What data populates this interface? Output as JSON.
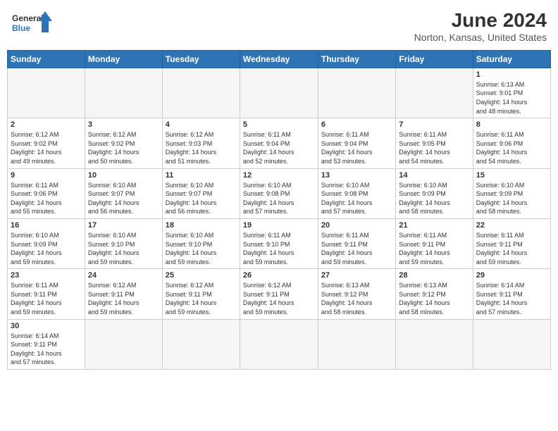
{
  "header": {
    "logo_line1": "General",
    "logo_line2": "Blue",
    "month_year": "June 2024",
    "location": "Norton, Kansas, United States"
  },
  "weekdays": [
    "Sunday",
    "Monday",
    "Tuesday",
    "Wednesday",
    "Thursday",
    "Friday",
    "Saturday"
  ],
  "weeks": [
    [
      {
        "day": "",
        "info": ""
      },
      {
        "day": "",
        "info": ""
      },
      {
        "day": "",
        "info": ""
      },
      {
        "day": "",
        "info": ""
      },
      {
        "day": "",
        "info": ""
      },
      {
        "day": "",
        "info": ""
      },
      {
        "day": "1",
        "info": "Sunrise: 6:13 AM\nSunset: 9:01 PM\nDaylight: 14 hours\nand 48 minutes."
      }
    ],
    [
      {
        "day": "2",
        "info": "Sunrise: 6:12 AM\nSunset: 9:02 PM\nDaylight: 14 hours\nand 49 minutes."
      },
      {
        "day": "3",
        "info": "Sunrise: 6:12 AM\nSunset: 9:02 PM\nDaylight: 14 hours\nand 50 minutes."
      },
      {
        "day": "4",
        "info": "Sunrise: 6:12 AM\nSunset: 9:03 PM\nDaylight: 14 hours\nand 51 minutes."
      },
      {
        "day": "5",
        "info": "Sunrise: 6:11 AM\nSunset: 9:04 PM\nDaylight: 14 hours\nand 52 minutes."
      },
      {
        "day": "6",
        "info": "Sunrise: 6:11 AM\nSunset: 9:04 PM\nDaylight: 14 hours\nand 53 minutes."
      },
      {
        "day": "7",
        "info": "Sunrise: 6:11 AM\nSunset: 9:05 PM\nDaylight: 14 hours\nand 54 minutes."
      },
      {
        "day": "8",
        "info": "Sunrise: 6:11 AM\nSunset: 9:06 PM\nDaylight: 14 hours\nand 54 minutes."
      }
    ],
    [
      {
        "day": "9",
        "info": "Sunrise: 6:11 AM\nSunset: 9:06 PM\nDaylight: 14 hours\nand 55 minutes."
      },
      {
        "day": "10",
        "info": "Sunrise: 6:10 AM\nSunset: 9:07 PM\nDaylight: 14 hours\nand 56 minutes."
      },
      {
        "day": "11",
        "info": "Sunrise: 6:10 AM\nSunset: 9:07 PM\nDaylight: 14 hours\nand 56 minutes."
      },
      {
        "day": "12",
        "info": "Sunrise: 6:10 AM\nSunset: 9:08 PM\nDaylight: 14 hours\nand 57 minutes."
      },
      {
        "day": "13",
        "info": "Sunrise: 6:10 AM\nSunset: 9:08 PM\nDaylight: 14 hours\nand 57 minutes."
      },
      {
        "day": "14",
        "info": "Sunrise: 6:10 AM\nSunset: 9:09 PM\nDaylight: 14 hours\nand 58 minutes."
      },
      {
        "day": "15",
        "info": "Sunrise: 6:10 AM\nSunset: 9:09 PM\nDaylight: 14 hours\nand 58 minutes."
      }
    ],
    [
      {
        "day": "16",
        "info": "Sunrise: 6:10 AM\nSunset: 9:09 PM\nDaylight: 14 hours\nand 59 minutes."
      },
      {
        "day": "17",
        "info": "Sunrise: 6:10 AM\nSunset: 9:10 PM\nDaylight: 14 hours\nand 59 minutes."
      },
      {
        "day": "18",
        "info": "Sunrise: 6:10 AM\nSunset: 9:10 PM\nDaylight: 14 hours\nand 59 minutes."
      },
      {
        "day": "19",
        "info": "Sunrise: 6:11 AM\nSunset: 9:10 PM\nDaylight: 14 hours\nand 59 minutes."
      },
      {
        "day": "20",
        "info": "Sunrise: 6:11 AM\nSunset: 9:11 PM\nDaylight: 14 hours\nand 59 minutes."
      },
      {
        "day": "21",
        "info": "Sunrise: 6:11 AM\nSunset: 9:11 PM\nDaylight: 14 hours\nand 59 minutes."
      },
      {
        "day": "22",
        "info": "Sunrise: 6:11 AM\nSunset: 9:11 PM\nDaylight: 14 hours\nand 59 minutes."
      }
    ],
    [
      {
        "day": "23",
        "info": "Sunrise: 6:11 AM\nSunset: 9:11 PM\nDaylight: 14 hours\nand 59 minutes."
      },
      {
        "day": "24",
        "info": "Sunrise: 6:12 AM\nSunset: 9:11 PM\nDaylight: 14 hours\nand 59 minutes."
      },
      {
        "day": "25",
        "info": "Sunrise: 6:12 AM\nSunset: 9:11 PM\nDaylight: 14 hours\nand 59 minutes."
      },
      {
        "day": "26",
        "info": "Sunrise: 6:12 AM\nSunset: 9:11 PM\nDaylight: 14 hours\nand 59 minutes."
      },
      {
        "day": "27",
        "info": "Sunrise: 6:13 AM\nSunset: 9:12 PM\nDaylight: 14 hours\nand 58 minutes."
      },
      {
        "day": "28",
        "info": "Sunrise: 6:13 AM\nSunset: 9:12 PM\nDaylight: 14 hours\nand 58 minutes."
      },
      {
        "day": "29",
        "info": "Sunrise: 6:14 AM\nSunset: 9:11 PM\nDaylight: 14 hours\nand 57 minutes."
      }
    ],
    [
      {
        "day": "30",
        "info": "Sunrise: 6:14 AM\nSunset: 9:11 PM\nDaylight: 14 hours\nand 57 minutes."
      },
      {
        "day": "",
        "info": ""
      },
      {
        "day": "",
        "info": ""
      },
      {
        "day": "",
        "info": ""
      },
      {
        "day": "",
        "info": ""
      },
      {
        "day": "",
        "info": ""
      },
      {
        "day": "",
        "info": ""
      }
    ]
  ]
}
